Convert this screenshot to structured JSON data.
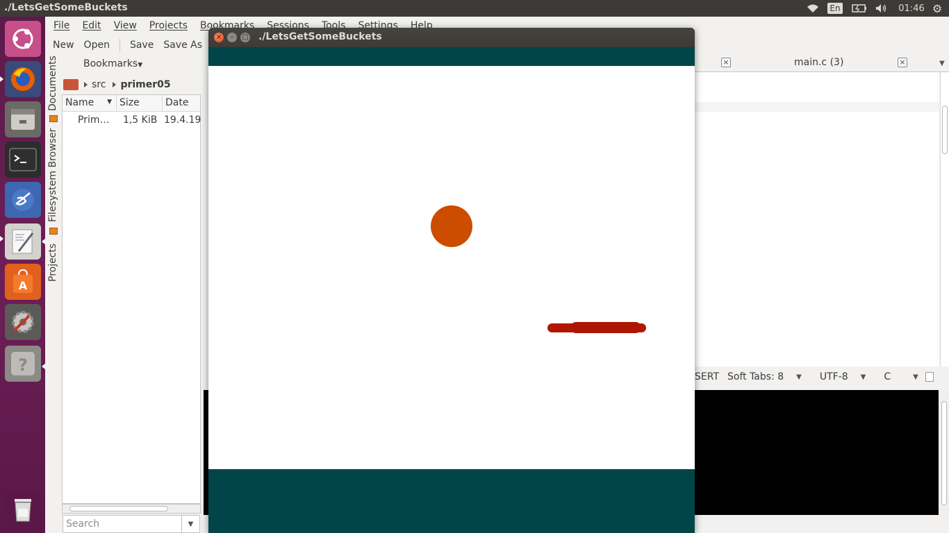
{
  "top_panel": {
    "window_title": "./LetsGetSomeBuckets",
    "keyboard_layout": "En",
    "clock": "01:46",
    "icons": [
      "wifi-icon",
      "battery-icon",
      "volume-icon",
      "gear-icon"
    ]
  },
  "launcher": {
    "items": [
      "ubuntu-dash",
      "firefox",
      "files",
      "terminal",
      "geany",
      "text-editor",
      "software-center",
      "system-settings",
      "help",
      "trash"
    ]
  },
  "geany": {
    "menu": [
      "File",
      "Edit",
      "View",
      "Projects",
      "Bookmarks",
      "Sessions",
      "Tools",
      "Settings",
      "Help"
    ],
    "toolbar": {
      "new": "New",
      "open": "Open",
      "save": "Save",
      "save_as": "Save As"
    },
    "sidebar_tabs": {
      "documents": "Documents",
      "filesystem": "Filesystem Browser",
      "projects": "Projects"
    },
    "file_browser": {
      "bookmarks": "Bookmarks",
      "path": [
        "src",
        "primer05"
      ],
      "columns": {
        "name": "Name",
        "size": "Size",
        "date": "Date"
      },
      "files": [
        {
          "name": "Prim…",
          "size": "1,5 KiB",
          "date": "19.4.19"
        }
      ],
      "search_placeholder": "Search"
    },
    "editor_tab": {
      "label": "main.c (3)"
    },
    "statusbar": {
      "mode": "SERT",
      "tabs": "Soft Tabs: 8",
      "encoding": "UTF-8",
      "filetype": "C"
    }
  },
  "game_window": {
    "title": "./LetsGetSomeBuckets",
    "band_color": "#024549",
    "ball_color": "#cc4c00",
    "paddle_color": "#b01800"
  }
}
